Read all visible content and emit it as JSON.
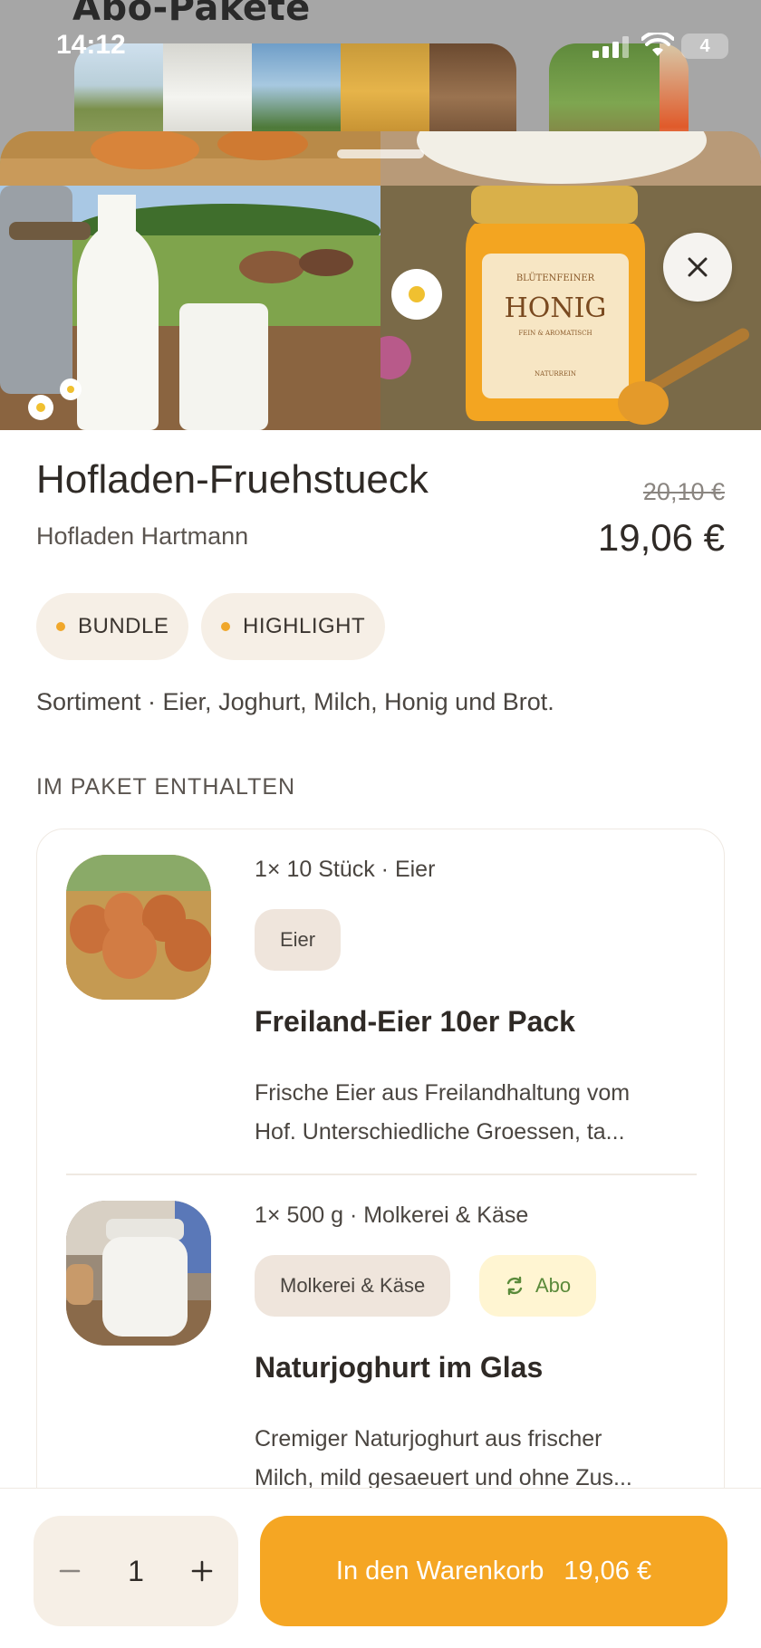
{
  "background": {
    "title": "Abo-Pakete"
  },
  "status_bar": {
    "time": "14:12",
    "battery": "4"
  },
  "product": {
    "title": "Hofladen-Fruehstueck",
    "vendor": "Hofladen Hartmann",
    "old_price": "20,10 €",
    "price": "19,06 €",
    "tags": [
      "BUNDLE",
      "HIGHLIGHT"
    ],
    "description": "Sortiment · Eier, Joghurt, Milch, Honig und Brot.",
    "hero_label": {
      "top": "BLÜTENFEINER",
      "main": "HONIG",
      "sub": "FEIN & AROMATISCH",
      "bottom": "NATURREIN"
    }
  },
  "section_title": "IM PAKET ENTHALTEN",
  "items": [
    {
      "qty": "1× 10 Stück · Eier",
      "chips": [
        "Eier"
      ],
      "name": "Freiland-Eier 10er Pack",
      "desc_line1": "Frische Eier aus Freilandhaltung vom",
      "desc_line2": "Hof. Unterschiedliche Groessen, ta..."
    },
    {
      "qty": "1× 500 g · Molkerei & Käse",
      "chips": [
        "Molkerei & Käse"
      ],
      "abo": "Abo",
      "name": "Naturjoghurt im Glas",
      "desc_line1": "Cremiger Naturjoghurt aus frischer",
      "desc_line2": "Milch, mild gesaeuert und ohne Zus..."
    }
  ],
  "bottom_bar": {
    "quantity": "1",
    "cart_label": "In den Warenkorb",
    "cart_price": "19,06 €"
  },
  "colors": {
    "accent": "#f5a623",
    "tag_bg": "#f6efe6",
    "abo_bg": "#fff5d2",
    "abo_text": "#5a8a3a"
  }
}
